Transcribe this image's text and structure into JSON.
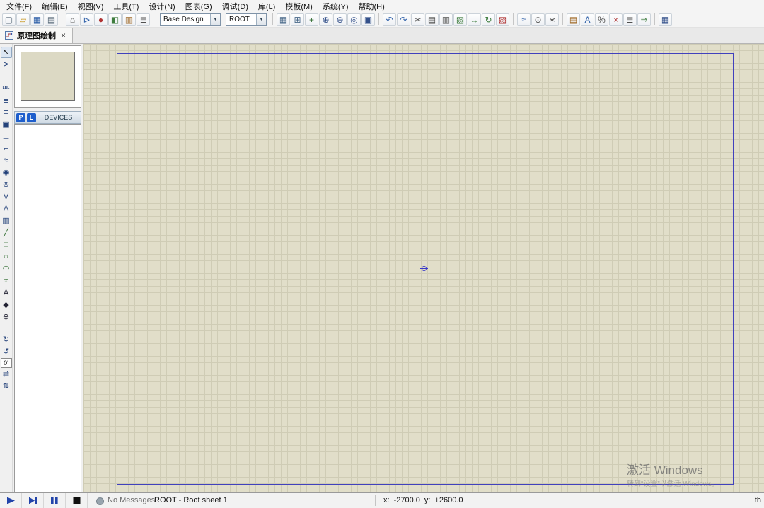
{
  "menu": {
    "items": [
      {
        "id": "file",
        "label": "文件(F)"
      },
      {
        "id": "edit",
        "label": "编辑(E)"
      },
      {
        "id": "view",
        "label": "视图(V)"
      },
      {
        "id": "tools",
        "label": "工具(T)"
      },
      {
        "id": "design",
        "label": "设计(N)"
      },
      {
        "id": "graph",
        "label": "图表(G)"
      },
      {
        "id": "debug",
        "label": "调试(D)"
      },
      {
        "id": "library",
        "label": "库(L)"
      },
      {
        "id": "template",
        "label": "模板(M)"
      },
      {
        "id": "system",
        "label": "系统(Y)"
      },
      {
        "id": "help",
        "label": "帮助(H)"
      }
    ]
  },
  "toolbar": {
    "groups": [
      {
        "name": "file",
        "icons": [
          {
            "name": "new-project",
            "glyph": "▢",
            "color": "#5a6b7a"
          },
          {
            "name": "open-project",
            "glyph": "▱",
            "color": "#c9971f"
          },
          {
            "name": "save-project",
            "glyph": "▦",
            "color": "#2d5fa8"
          },
          {
            "name": "import-section",
            "glyph": "▤",
            "color": "#5a6b7a"
          }
        ]
      },
      {
        "name": "modules",
        "icons": [
          {
            "name": "home-page",
            "glyph": "⌂",
            "color": "#50504f"
          },
          {
            "name": "schematic-capture",
            "glyph": "⊳",
            "color": "#2d5fa8"
          },
          {
            "name": "pcb-layout",
            "glyph": "●",
            "color": "#b03434"
          },
          {
            "name": "3d-visualizer",
            "glyph": "◧",
            "color": "#3f7d3f"
          },
          {
            "name": "design-explorer",
            "glyph": "▥",
            "color": "#a06a28"
          },
          {
            "name": "source-code",
            "glyph": "≣",
            "color": "#50504f"
          }
        ]
      },
      {
        "name": "selectors",
        "type": "dropdowns",
        "dropdowns": [
          {
            "name": "design-variant",
            "value": "Base Design",
            "width": 86
          },
          {
            "name": "sheet",
            "value": "ROOT",
            "width": 58
          }
        ]
      },
      {
        "name": "view",
        "icons": [
          {
            "name": "toggle-grid",
            "glyph": "▦",
            "color": "#4a6a8a"
          },
          {
            "name": "false-origin",
            "glyph": "⊞",
            "color": "#4a6a8a"
          },
          {
            "name": "center-at-cursor",
            "glyph": "+",
            "color": "#2d6a2d"
          },
          {
            "name": "zoom-in",
            "glyph": "⊕",
            "color": "#33508a"
          },
          {
            "name": "zoom-out",
            "glyph": "⊖",
            "color": "#33508a"
          },
          {
            "name": "zoom-all",
            "glyph": "◎",
            "color": "#33508a"
          },
          {
            "name": "zoom-area",
            "glyph": "▣",
            "color": "#33508a"
          }
        ]
      },
      {
        "name": "edit",
        "icons": [
          {
            "name": "undo",
            "glyph": "↶",
            "color": "#2d5fa8"
          },
          {
            "name": "redo",
            "glyph": "↷",
            "color": "#2d5fa8"
          },
          {
            "name": "cut",
            "glyph": "✂",
            "color": "#50504f"
          },
          {
            "name": "copy",
            "glyph": "▤",
            "color": "#50504f"
          },
          {
            "name": "paste",
            "glyph": "▥",
            "color": "#50504f"
          },
          {
            "name": "block-copy",
            "glyph": "▧",
            "color": "#3f7d3f"
          },
          {
            "name": "block-move",
            "glyph": "↔",
            "color": "#3f7d3f"
          },
          {
            "name": "block-rotate",
            "glyph": "↻",
            "color": "#3f7d3f"
          },
          {
            "name": "block-delete",
            "glyph": "▨",
            "color": "#b03434"
          }
        ]
      },
      {
        "name": "tools",
        "icons": [
          {
            "name": "wire-autorouter",
            "glyph": "≈",
            "color": "#2d5fa8"
          },
          {
            "name": "search-tag",
            "glyph": "⊙",
            "color": "#50504f"
          },
          {
            "name": "property-assignment",
            "glyph": "∗",
            "color": "#50504f"
          }
        ]
      },
      {
        "name": "design-tools",
        "icons": [
          {
            "name": "design-explorer-list",
            "glyph": "▤",
            "color": "#a06a28"
          },
          {
            "name": "find-and-edit",
            "glyph": "A",
            "color": "#2d5fa8"
          },
          {
            "name": "property-editor",
            "glyph": "%",
            "color": "#50504f"
          },
          {
            "name": "electrical-rule-check",
            "glyph": "×",
            "color": "#b03434"
          },
          {
            "name": "bill-of-materials",
            "glyph": "≣",
            "color": "#50504f"
          },
          {
            "name": "netlist-to-ares",
            "glyph": "⇒",
            "color": "#3f7d3f"
          }
        ]
      },
      {
        "name": "misc",
        "icons": [
          {
            "name": "simulation-log",
            "glyph": "▦",
            "color": "#33508a"
          }
        ]
      }
    ]
  },
  "tabbar": {
    "active_tab": {
      "label": "原理图绘制",
      "close_glyph": "×"
    }
  },
  "sidebar": {
    "tools": [
      {
        "name": "selection-mode",
        "glyph": "↖",
        "color": "#222222",
        "active": true
      },
      {
        "name": "component-mode",
        "glyph": "⊳",
        "color": "#24427a"
      },
      {
        "name": "junction-dot-mode",
        "glyph": "+",
        "color": "#24427a"
      },
      {
        "name": "wire-label-mode",
        "glyph": "LBL",
        "color": "#24427a"
      },
      {
        "name": "text-script-mode",
        "glyph": "≣",
        "color": "#24427a"
      },
      {
        "name": "buses-mode",
        "glyph": "≡",
        "color": "#24427a"
      },
      {
        "name": "subcircuit-mode",
        "glyph": "▣",
        "color": "#24427a"
      },
      {
        "name": "terminals-mode",
        "glyph": "⊥",
        "color": "#24427a"
      },
      {
        "name": "device-pins-mode",
        "glyph": "⌐",
        "color": "#24427a"
      },
      {
        "name": "graph-mode",
        "glyph": "≈",
        "color": "#24427a"
      },
      {
        "name": "tape-recorder-mode",
        "glyph": "◉",
        "color": "#24427a"
      },
      {
        "name": "generator-mode",
        "glyph": "⊚",
        "color": "#24427a"
      },
      {
        "name": "voltage-probe-mode",
        "glyph": "V",
        "color": "#24427a"
      },
      {
        "name": "current-probe-mode",
        "glyph": "A",
        "color": "#24427a"
      },
      {
        "name": "virtual-instruments-mode",
        "glyph": "▥",
        "color": "#24427a"
      },
      {
        "name": "line-mode",
        "glyph": "╱",
        "color": "#2d6a2d"
      },
      {
        "name": "box-mode",
        "glyph": "□",
        "color": "#2d6a2d"
      },
      {
        "name": "circle-mode",
        "glyph": "○",
        "color": "#2d6a2d"
      },
      {
        "name": "arc-mode",
        "glyph": "◠",
        "color": "#2d6a2d"
      },
      {
        "name": "path-mode",
        "glyph": "∞",
        "color": "#2d6a2d"
      },
      {
        "name": "text-mode",
        "glyph": "A",
        "color": "#222233"
      },
      {
        "name": "symbol-mode",
        "glyph": "◆",
        "color": "#222233"
      },
      {
        "name": "marker-mode",
        "glyph": "⊕",
        "color": "#222233"
      }
    ],
    "rotation": {
      "rotate": [
        {
          "name": "rotate-clockwise",
          "glyph": "↻",
          "color": "#24427a"
        },
        {
          "name": "rotate-anticlockwise",
          "glyph": "↺",
          "color": "#24427a"
        }
      ],
      "angle": "0'",
      "mirror": [
        {
          "name": "x-mirror",
          "glyph": "⇄",
          "color": "#24427a"
        },
        {
          "name": "y-mirror",
          "glyph": "⇅",
          "color": "#24427a"
        }
      ]
    }
  },
  "devices_panel": {
    "pick_button": "P",
    "library_button": "L",
    "title": "DEVICES"
  },
  "statusbar": {
    "no_messages": "No Messages",
    "sheet_label": "ROOT - Root sheet 1",
    "coords": {
      "x_label": "x:",
      "x_value": "-2700.0",
      "y_label": "y:",
      "y_value": "+2600.0"
    },
    "right_text": "th"
  },
  "watermark": {
    "line1": "激活 Windows",
    "line2": "转到“设置”以激活 Windows。"
  }
}
